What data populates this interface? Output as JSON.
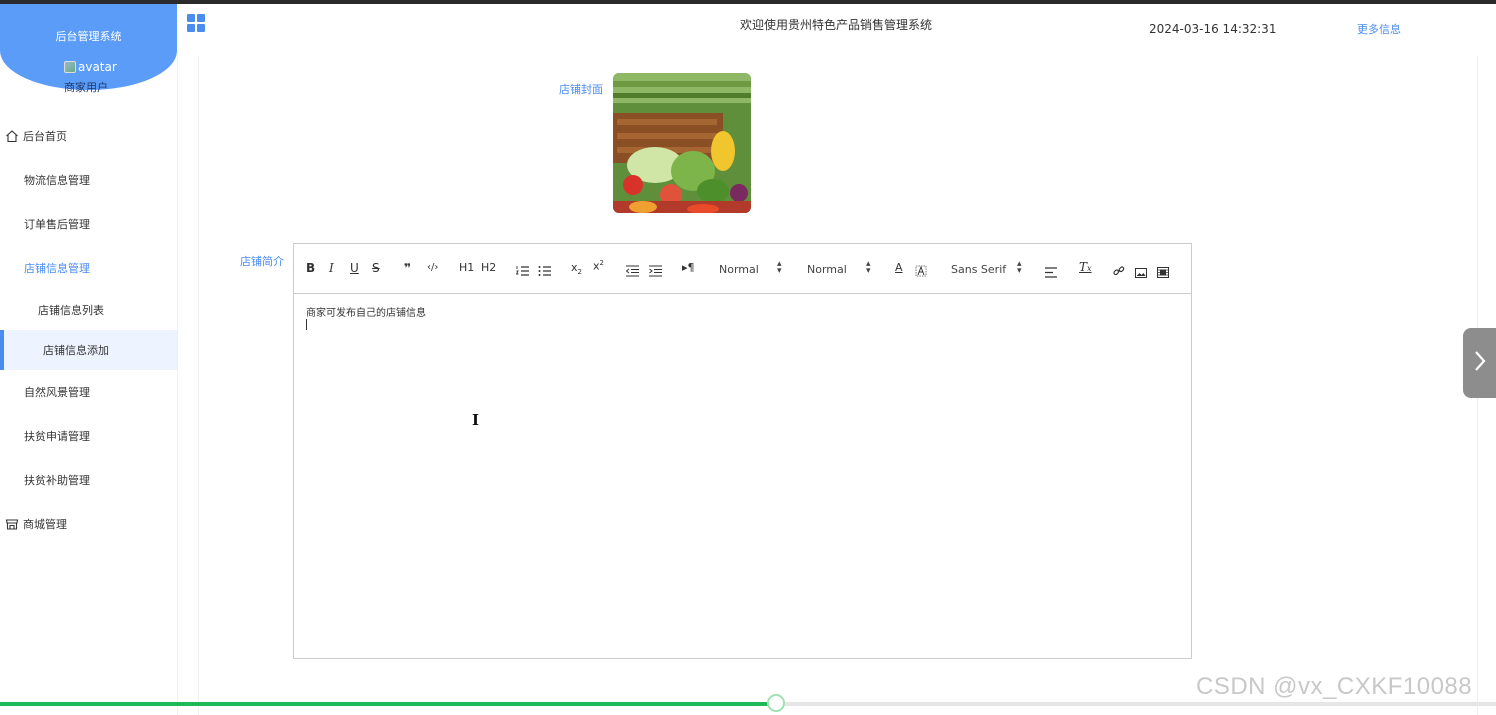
{
  "sidebar": {
    "brand_title": "后台管理系统",
    "avatar_alt": "avatar",
    "username": "商家用户",
    "items": [
      {
        "label": "后台首页",
        "icon": "home-icon"
      },
      {
        "label": "物流信息管理"
      },
      {
        "label": "订单售后管理"
      },
      {
        "label": "店铺信息管理",
        "expanded": true
      },
      {
        "label": "店铺信息列表"
      },
      {
        "label": "店铺信息添加",
        "selected": true
      },
      {
        "label": "自然风景管理"
      },
      {
        "label": "扶贫申请管理"
      },
      {
        "label": "扶贫补助管理"
      },
      {
        "label": "商城管理",
        "icon": "shop-icon"
      }
    ]
  },
  "header": {
    "welcome": "欢迎使用贵州特色产品销售管理系统",
    "datetime": "2024-03-16 14:32:31",
    "more_info": "更多信息",
    "menu_icon": "grid-icon"
  },
  "form": {
    "cover_label": "店铺封面",
    "intro_label": "店铺简介"
  },
  "editor": {
    "toolbar": {
      "bold": "B",
      "italic": "I",
      "underline": "U",
      "strike": "S",
      "blockquote": "❞",
      "code": "‹/›",
      "h1": "H1",
      "h2": "H2",
      "size_select": "Normal",
      "header_select": "Normal",
      "font_select": "Sans Serif",
      "color": "A",
      "font_color_underline": "#000000"
    },
    "content": "商家可发布自己的店铺信息"
  },
  "player": {
    "progress": 0.52,
    "accent": "#1db954"
  },
  "watermark": "CSDN @vx_CXKF10088",
  "colors": {
    "primary": "#4a8cf0",
    "brand_bg": "#5a9cf8"
  }
}
